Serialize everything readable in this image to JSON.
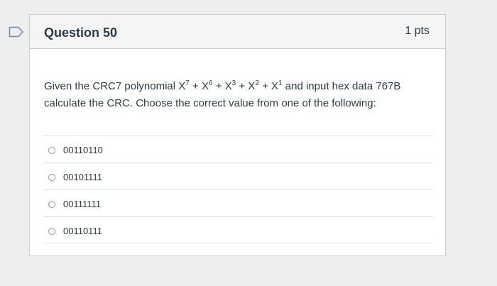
{
  "question": {
    "title": "Question 50",
    "points": "1 pts",
    "text": {
      "before_poly": "Given the CRC7 polynomial ",
      "terms": [
        {
          "base": "X",
          "exp": "7"
        },
        {
          "base": "X",
          "exp": "6"
        },
        {
          "base": "X",
          "exp": "3"
        },
        {
          "base": "X",
          "exp": "2"
        },
        {
          "base": "X",
          "exp": "1"
        }
      ],
      "plus": " + ",
      "after_poly": " and input hex data 767B",
      "line2": "calculate the CRC. Choose the correct value from one of the following:"
    },
    "answers": [
      {
        "label": "00110110",
        "selected": false
      },
      {
        "label": "00101111",
        "selected": false
      },
      {
        "label": "00111111",
        "selected": false
      },
      {
        "label": "00110111",
        "selected": false
      }
    ]
  },
  "colors": {
    "flag_icon": "#6c86c4",
    "text": "#2d3b45",
    "border": "#c7cdd1",
    "background": "#eeeeee"
  }
}
